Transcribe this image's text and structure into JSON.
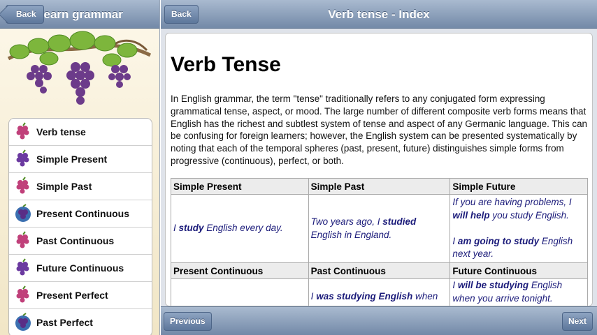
{
  "left_panel": {
    "back_label": "Back",
    "title": "Learn grammar",
    "menu": [
      {
        "label": "Verb tense",
        "icon": "grapes-pink-icon"
      },
      {
        "label": "Simple Present",
        "icon": "grapes-purple-icon"
      },
      {
        "label": "Simple Past",
        "icon": "grapes-pink-icon"
      },
      {
        "label": "Present Continuous",
        "icon": "grapes-globe-icon"
      },
      {
        "label": "Past Continuous",
        "icon": "grapes-pink-icon"
      },
      {
        "label": "Future Continuous",
        "icon": "grapes-purple-icon"
      },
      {
        "label": "Present Perfect",
        "icon": "grapes-pink-icon"
      },
      {
        "label": "Past Perfect",
        "icon": "grapes-globe-icon"
      }
    ]
  },
  "right_panel": {
    "back_label": "Back",
    "title": "Verb tense - Index",
    "doc_title": "Verb Tense",
    "intro": "In English grammar, the term \"tense\" traditionally refers to any conjugated form expressing grammatical tense, aspect, or mood. The large number of different composite verb forms means that English has the richest and subtlest system of tense and aspect of any Germanic language. This can be confusing for foreign learners; however, the English system can be presented systematically by noting that each of the temporal spheres (past, present, future) distinguishes simple forms from progressive (continuous), perfect, or both.",
    "table": {
      "headers1": [
        "Simple Present",
        "Simple Past",
        "Simple Future"
      ],
      "row1": {
        "c1_pre": "I ",
        "c1_bold": "study",
        "c1_post": " English every day.",
        "c2_pre": "Two years ago, I ",
        "c2_bold": "studied",
        "c2_post": " English in England.",
        "c3a_pre": "If you are having problems, I ",
        "c3a_bold": "will help",
        "c3a_post": " you study English.",
        "c3b_pre": "I ",
        "c3b_bold": "am going to study",
        "c3b_post": " English next year."
      },
      "headers2": [
        "Present Continuous",
        "Past Continuous",
        "Future Continuous"
      ],
      "row2": {
        "c2_pre": "I ",
        "c2_bold": "was studying English",
        "c2_post": " when you",
        "c3_pre": "I ",
        "c3_bold": "will be studying",
        "c3_post": " English when you arrive tonight."
      }
    },
    "previous_label": "Previous",
    "next_label": "Next"
  }
}
